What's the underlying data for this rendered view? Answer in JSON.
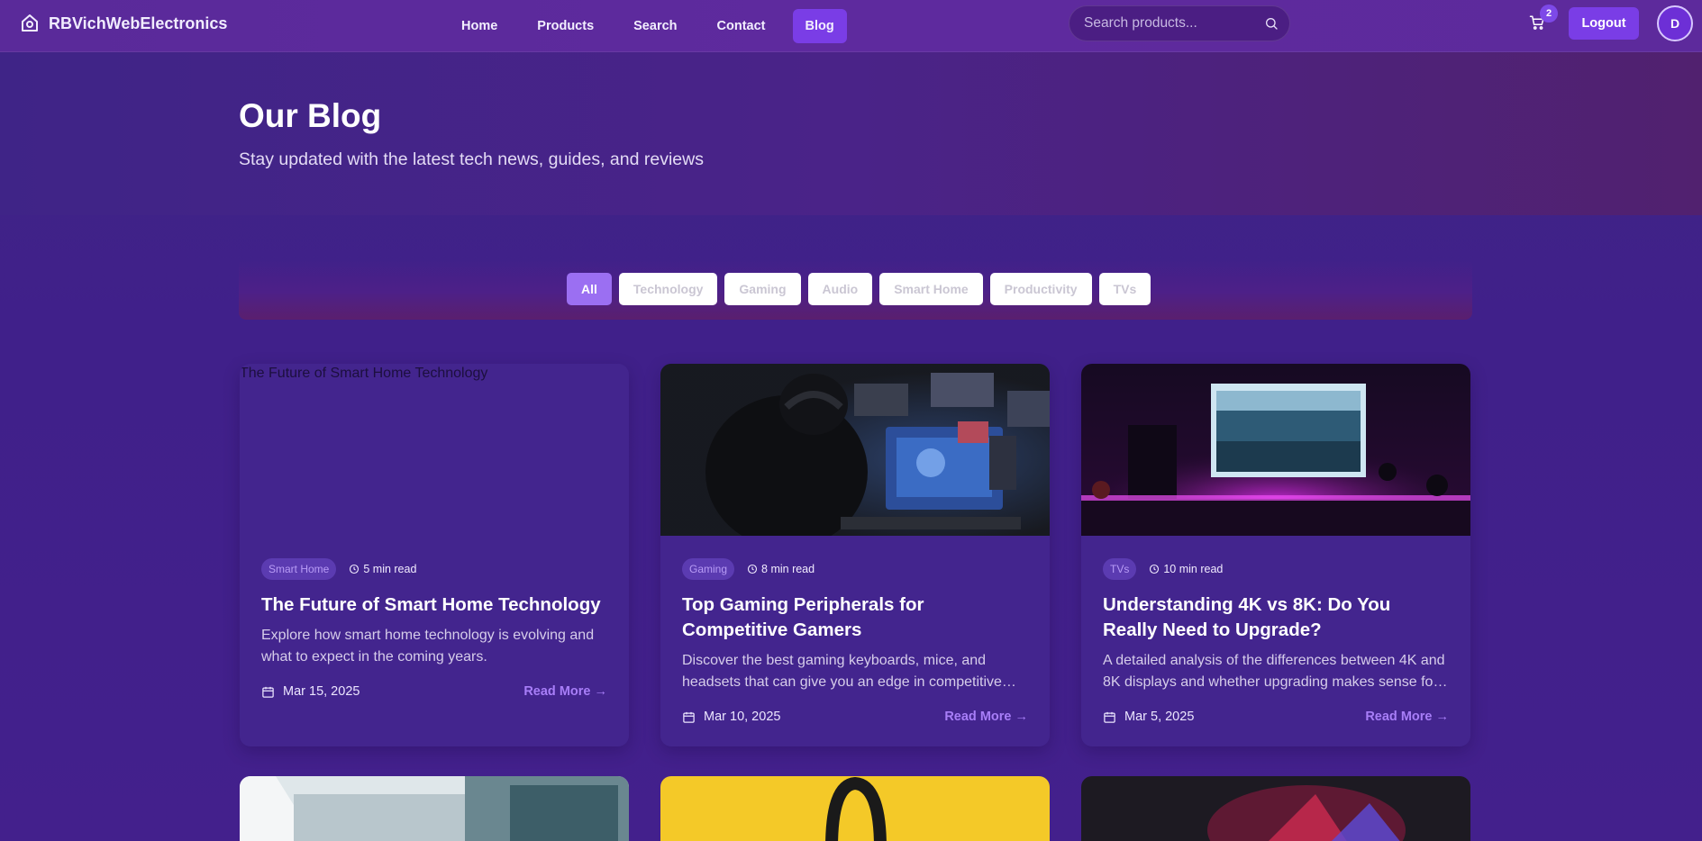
{
  "nav": {
    "brand": "RBVichWebElectronics",
    "links": [
      "Home",
      "Products",
      "Search",
      "Contact",
      "Blog"
    ],
    "active_link": "Blog",
    "search_placeholder": "Search products...",
    "cart_count": "2",
    "logout_label": "Logout",
    "avatar_initial": "D"
  },
  "hero": {
    "title": "Our Blog",
    "subtitle": "Stay updated with the latest tech news, guides, and reviews"
  },
  "filters": {
    "items": [
      "All",
      "Technology",
      "Gaming",
      "Audio",
      "Smart Home",
      "Productivity",
      "TVs"
    ],
    "active": "All"
  },
  "posts": [
    {
      "image_alt": "The Future of Smart Home Technology",
      "category": "Smart Home",
      "read_time": "5 min read",
      "title": "The Future of Smart Home Technology",
      "excerpt": "Explore how smart home technology is evolving and what to expect in the coming years.",
      "date": "Mar 15, 2025",
      "read_more": "Read More →"
    },
    {
      "category": "Gaming",
      "read_time": "8 min read",
      "title": "Top Gaming Peripherals for Competitive Gamers",
      "excerpt": "Discover the best gaming keyboards, mice, and headsets that can give you an edge in competitive gaming.",
      "date": "Mar 10, 2025",
      "read_more": "Read More →"
    },
    {
      "category": "TVs",
      "read_time": "10 min read",
      "title": "Understanding 4K vs 8K: Do You Really Need to Upgrade?",
      "excerpt": "A detailed analysis of the differences between 4K and 8K displays and whether upgrading makes sense for you.",
      "date": "Mar 5, 2025",
      "read_more": "Read More →"
    }
  ],
  "colors": {
    "accent": "#7a3de6",
    "chip_active": "#9b6ff2",
    "read_more": "#a87ef8",
    "card_bg": "#43258e"
  }
}
